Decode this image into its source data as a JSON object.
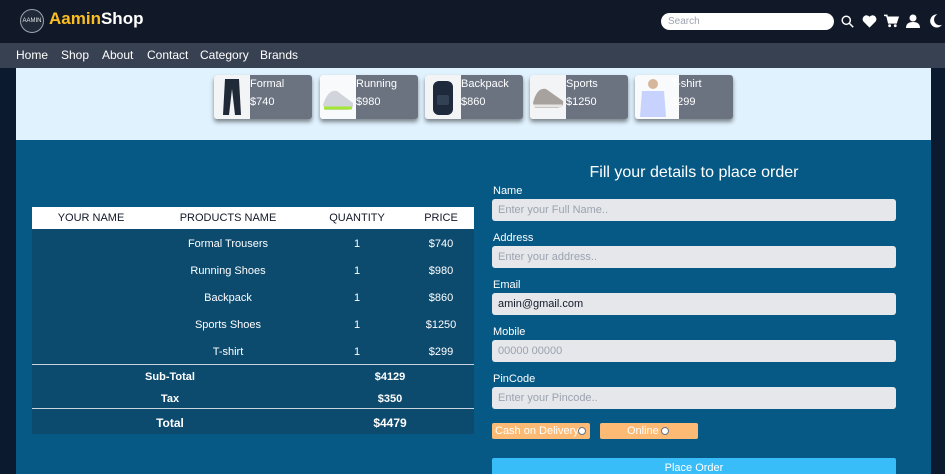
{
  "header": {
    "brand_part1": "Aamin",
    "brand_part2": "Shop",
    "logo_text": "AAMIN",
    "search_placeholder": "Search",
    "icons": [
      "search-icon",
      "heart-icon",
      "cart-icon",
      "user-icon",
      "moon-icon"
    ]
  },
  "nav": {
    "items": [
      "Home",
      "Shop",
      "About",
      "Contact",
      "Category",
      "Brands"
    ]
  },
  "products": [
    {
      "name": "Formal",
      "price": "$740",
      "image": "trousers"
    },
    {
      "name": "Running",
      "price": "$980",
      "image": "shoe"
    },
    {
      "name": "Backpack",
      "price": "$860",
      "image": "backpack"
    },
    {
      "name": "Sports",
      "price": "$1250",
      "image": "shoe"
    },
    {
      "name": "T-shirt",
      "price": "$299",
      "image": "shirt"
    }
  ],
  "table": {
    "headers": [
      "YOUR NAME",
      "PRODUCTS NAME",
      "QUANTITY",
      "PRICE"
    ],
    "rows": [
      {
        "name": "",
        "product": "Formal Trousers",
        "qty": "1",
        "price": "$740"
      },
      {
        "name": "",
        "product": "Running Shoes",
        "qty": "1",
        "price": "$980"
      },
      {
        "name": "",
        "product": "Backpack",
        "qty": "1",
        "price": "$860"
      },
      {
        "name": "",
        "product": "Sports Shoes",
        "qty": "1",
        "price": "$1250"
      },
      {
        "name": "",
        "product": "T-shirt",
        "qty": "1",
        "price": "$299"
      }
    ],
    "subtotal_label": "Sub-Total",
    "subtotal_value": "$4129",
    "tax_label": "Tax",
    "tax_value": "$350",
    "total_label": "Total",
    "total_value": "$4479"
  },
  "form": {
    "title": "Fill your details to place order",
    "name_label": "Name",
    "name_placeholder": "Enter your Full Name..",
    "address_label": "Address",
    "address_placeholder": "Enter your address..",
    "email_label": "Email",
    "email_value": "amin@gmail.com",
    "mobile_label": "Mobile",
    "mobile_placeholder": "00000 00000",
    "pincode_label": "PinCode",
    "pincode_placeholder": "Enter your Pincode..",
    "payment_options": [
      "Cash on Delivery",
      "Online"
    ],
    "submit_label": "Place Order"
  },
  "colors": {
    "brand_accent": "#fbbf24",
    "header_bg": "#111827",
    "nav_bg": "#374151",
    "panel_bg": "#075985",
    "table_bg": "#0c4a6e",
    "button_bg": "#38bdf8",
    "payment_bg": "#fdba74"
  }
}
